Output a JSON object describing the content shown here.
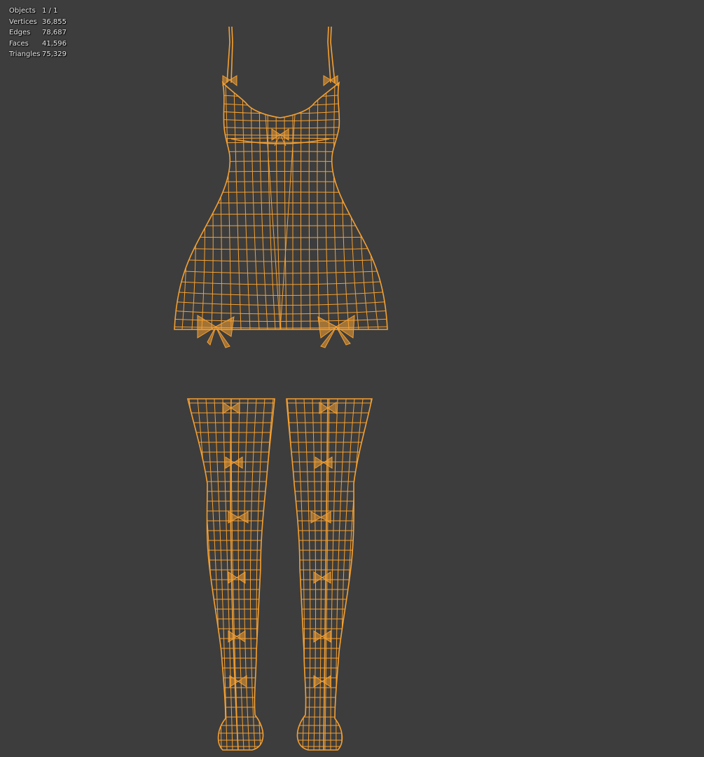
{
  "stats": {
    "rows": [
      {
        "label": "Objects",
        "value": "1 / 1"
      },
      {
        "label": "Vertices",
        "value": "36,855"
      },
      {
        "label": "Edges",
        "value": "78,687"
      },
      {
        "label": "Faces",
        "value": "41,596"
      },
      {
        "label": "Triangles",
        "value": "75,329"
      }
    ]
  },
  "colors": {
    "background": "#3d3d3d",
    "wireframe": "#f5a031",
    "text": "#e6e6e6"
  },
  "objects": {
    "dress": "wireframe-dress-mesh",
    "stockings": "wireframe-stockings-mesh"
  }
}
